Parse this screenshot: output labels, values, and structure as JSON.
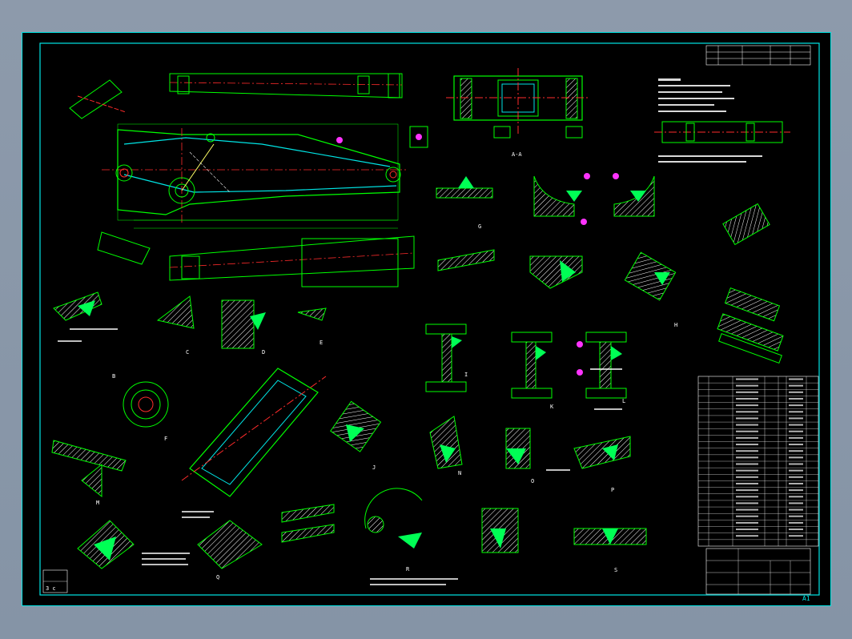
{
  "viewer": {
    "background_color": "#8a97a8",
    "canvas_color": "#000000"
  },
  "drawing": {
    "colors": {
      "frame": "#00e5e5",
      "outline": "#00ff00",
      "centerline": "#ff2b2b",
      "hidden": "#4a7bff",
      "weld_fill": "#00ff55",
      "marker": "#ff33ff",
      "text": "#ffffff"
    },
    "section_labels": [
      "A-A",
      "B",
      "C",
      "D",
      "E",
      "F",
      "G",
      "H",
      "I",
      "J",
      "K",
      "L",
      "M",
      "N",
      "O",
      "P",
      "Q",
      "R",
      "S"
    ],
    "corner_label": "A1",
    "title_block_mark": "3 c"
  },
  "parts_list": {
    "row_count": 26
  }
}
